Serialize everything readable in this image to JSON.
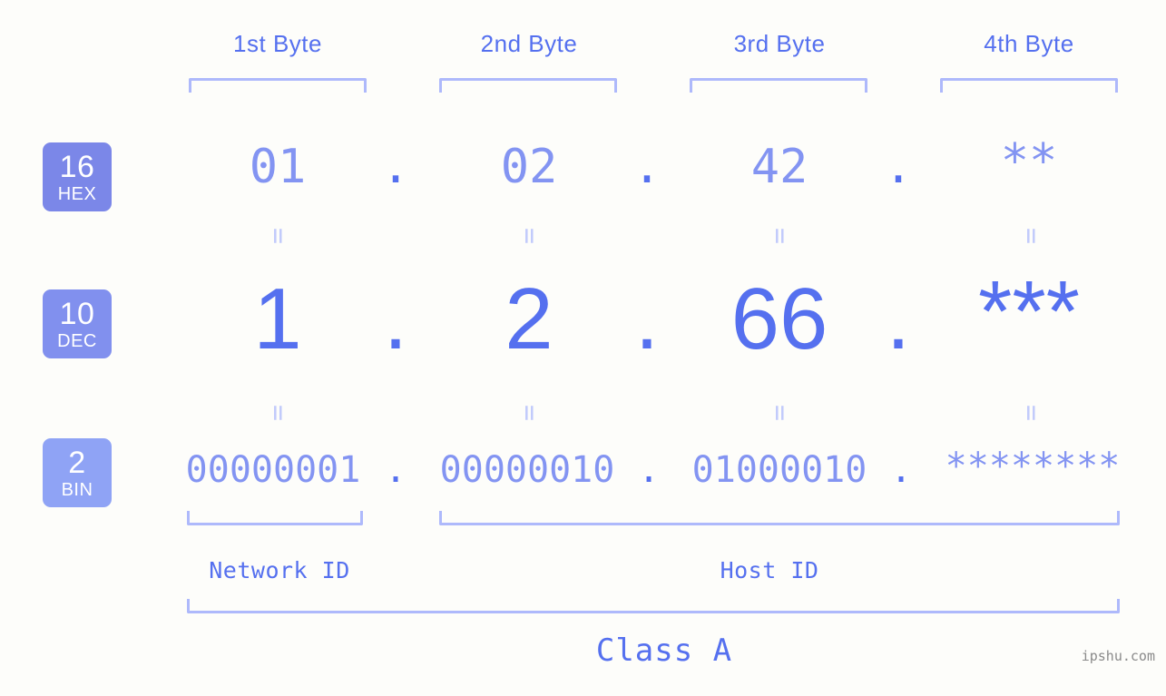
{
  "colors": {
    "background": "#fdfdfa",
    "accent_strong": "#5570ef",
    "accent_mid": "#8394f2",
    "accent_light": "#aeb9fb",
    "accent_faint": "#c2cbfb",
    "badge_hex": "#7b87e8",
    "badge_dec": "#8190ee",
    "badge_bin": "#8fa3f5",
    "watermark": "#8a8a8a"
  },
  "byte_headers": [
    {
      "label": "1st Byte"
    },
    {
      "label": "2nd Byte"
    },
    {
      "label": "3rd Byte"
    },
    {
      "label": "4th Byte"
    }
  ],
  "bases": [
    {
      "num": "16",
      "name": "HEX"
    },
    {
      "num": "10",
      "name": "DEC"
    },
    {
      "num": "2",
      "name": "BIN"
    }
  ],
  "rows": {
    "hex": {
      "values": [
        "01",
        "02",
        "42",
        "**"
      ],
      "separator": "."
    },
    "dec": {
      "values": [
        "1",
        "2",
        "66",
        "***"
      ],
      "separator": "."
    },
    "bin": {
      "values": [
        "00000001",
        "00000010",
        "01000010",
        "********"
      ],
      "separator": "."
    }
  },
  "equals_glyph": "=",
  "segments": {
    "network_id": "Network ID",
    "host_id": "Host ID",
    "class": "Class A"
  },
  "watermark": "ipshu.com"
}
